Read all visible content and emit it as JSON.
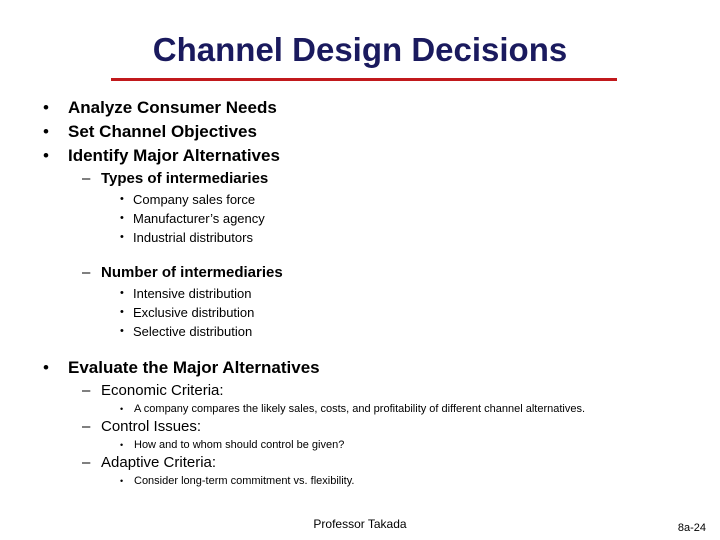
{
  "slide": {
    "title": "Channel Design Decisions",
    "accent_rule_color": "#c1191c",
    "title_color": "#1a1a5e",
    "body_color": "#000000",
    "background_color": "#ffffff"
  },
  "markers": {
    "disc": "•",
    "dash": "–"
  },
  "outline": [
    {
      "level": 1,
      "text": "Analyze Consumer Needs"
    },
    {
      "level": 1,
      "text": "Set Channel Objectives"
    },
    {
      "level": 1,
      "text": "Identify Major Alternatives"
    },
    {
      "level": 2,
      "text": "Types of intermediaries"
    },
    {
      "level": 3,
      "text": "Company sales force"
    },
    {
      "level": 3,
      "text": "Manufacturer’s agency"
    },
    {
      "level": 3,
      "text": "Industrial distributors"
    },
    {
      "level": 2,
      "text": "Number of intermediaries"
    },
    {
      "level": 3,
      "text": "Intensive distribution"
    },
    {
      "level": 3,
      "text": "Exclusive distribution"
    },
    {
      "level": 3,
      "text": "Selective distribution"
    },
    {
      "level": 1,
      "text": "Evaluate the Major Alternatives"
    },
    {
      "level": 2,
      "text": "Economic Criteria:"
    },
    {
      "level": 4,
      "text": "A company compares the likely sales, costs, and profitability of different channel alternatives."
    },
    {
      "level": 2,
      "text": "Control Issues:"
    },
    {
      "level": 4,
      "text": "How and to whom should control be given?"
    },
    {
      "level": 2,
      "text": "Adaptive Criteria:"
    },
    {
      "level": 4,
      "text": "Consider long-term commitment vs. flexibility."
    }
  ],
  "footer": {
    "author": "Professor Takada",
    "page_number": "8a-24"
  }
}
